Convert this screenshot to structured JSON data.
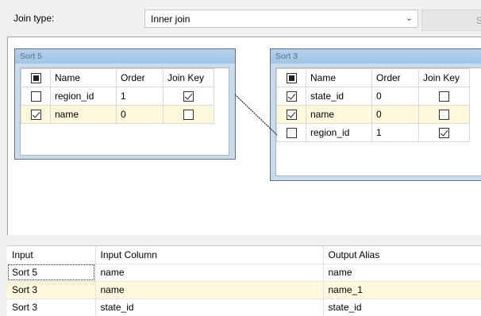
{
  "toolbar": {
    "join_type_label": "Join type:",
    "join_type_value": "Inner join",
    "swap_button_label": "Sw"
  },
  "left_table": {
    "title": "Sort 5",
    "headers": {
      "name": "Name",
      "order": "Order",
      "join_key": "Join Key"
    },
    "rows": [
      {
        "name": "region_id",
        "order": "1",
        "selected": false,
        "join_key": true
      },
      {
        "name": "name",
        "order": "0",
        "selected": true,
        "join_key": false
      }
    ]
  },
  "right_table": {
    "title": "Sort 3",
    "headers": {
      "name": "Name",
      "order": "Order",
      "join_key": "Join Key"
    },
    "rows": [
      {
        "name": "state_id",
        "order": "0",
        "selected": true,
        "join_key": false
      },
      {
        "name": "name",
        "order": "0",
        "selected": true,
        "join_key": false
      },
      {
        "name": "region_id",
        "order": "1",
        "selected": false,
        "join_key": true
      }
    ]
  },
  "output_grid": {
    "headers": {
      "input": "Input",
      "input_column": "Input Column",
      "output_alias": "Output Alias"
    },
    "rows": [
      {
        "input": "Sort 5",
        "input_column": "name",
        "output_alias": "name"
      },
      {
        "input": "Sort 3",
        "input_column": "name",
        "output_alias": "name_1"
      },
      {
        "input": "Sort 3",
        "input_column": "state_id",
        "output_alias": "state_id"
      }
    ]
  },
  "colors": {
    "selected_row": "#fff8dd",
    "box_header": "#a3c4e6",
    "box_body": "#c8dcf0"
  }
}
